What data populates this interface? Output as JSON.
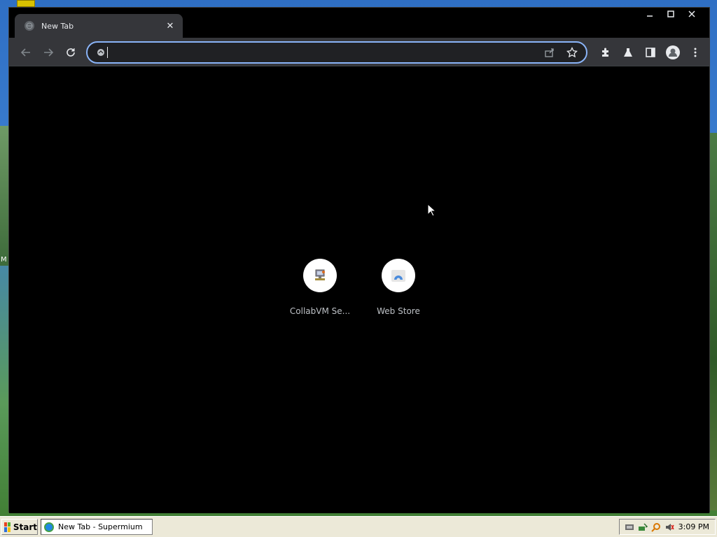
{
  "window": {
    "tab_title": "New Tab",
    "tab_close_glyph": "✕",
    "minimize_glyph": "—",
    "maximize_glyph": "▢",
    "close_glyph": "✕"
  },
  "toolbar": {
    "address_value": "",
    "address_placeholder": "",
    "icons": [
      "back-icon",
      "forward-icon",
      "reload-icon",
      "site-info-icon",
      "share-icon",
      "bookmark-star-icon",
      "extensions-icon",
      "labs-icon",
      "side-panel-icon",
      "profile-icon",
      "menu-icon"
    ]
  },
  "shortcuts": [
    {
      "label": "CollabVM Se...",
      "icon": "collabvm-icon"
    },
    {
      "label": "Web Store",
      "icon": "web-store-icon"
    }
  ],
  "desktop": {
    "edge_text": "M"
  },
  "taskbar": {
    "start_label": "Start",
    "task_label": "New Tab - Supermium",
    "clock": "3:09 PM",
    "tray_icons": [
      "network-icon",
      "safely-remove-icon",
      "search-icon",
      "speaker-icon"
    ]
  },
  "colors": {
    "accent": "#8ab4f8",
    "toolbar_bg": "#35363a",
    "page_bg": "#000000"
  }
}
